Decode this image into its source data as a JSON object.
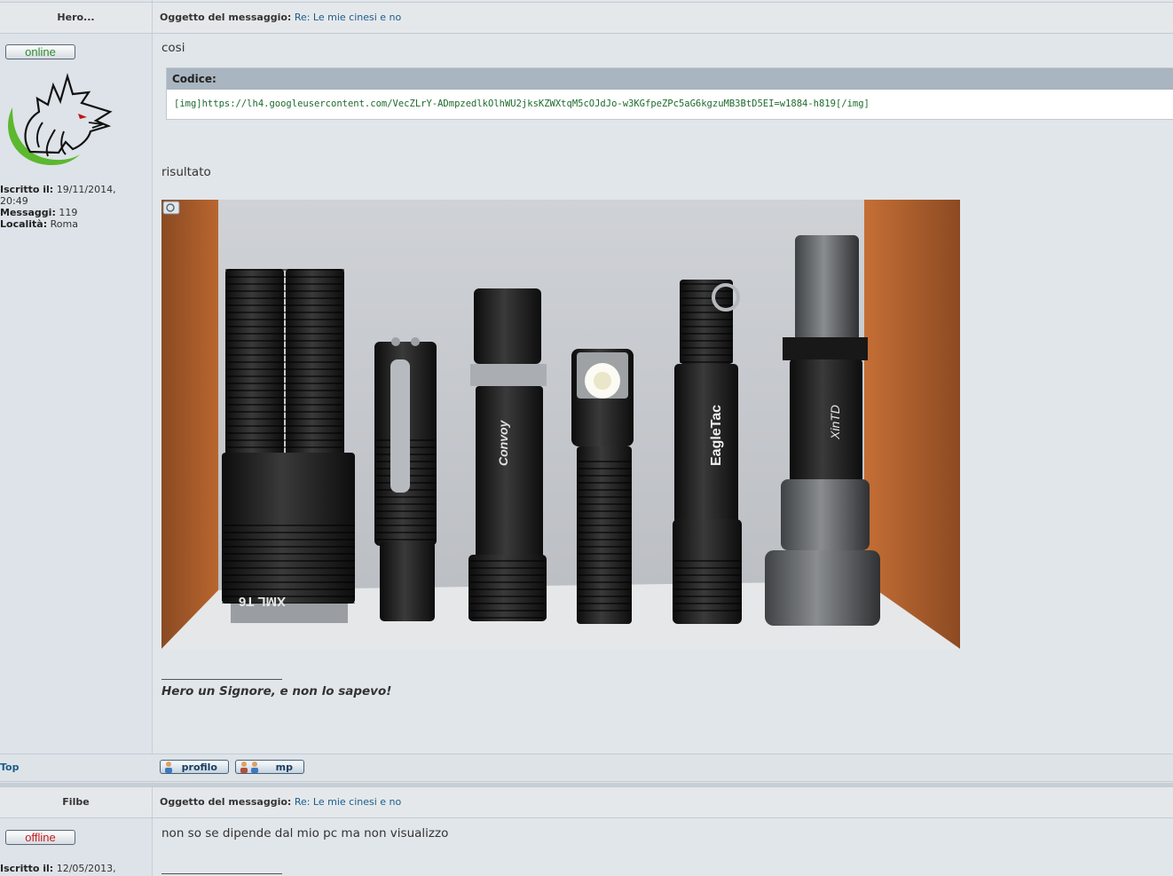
{
  "posts": [
    {
      "author": "Hero...",
      "subject_label": "Oggetto del messaggio:",
      "subject": "Re: Le mie cinesi e no",
      "status": "online",
      "joined_label": "Iscritto il:",
      "joined": "19/11/2014, 20:49",
      "joined_date": "19/11/2014,",
      "joined_time": "20:49",
      "messages_label": "Messaggi:",
      "messages": "119",
      "location_label": "Località:",
      "location": "Roma",
      "body_first": "cosi",
      "code_label": "Codice:",
      "code": "[img]https://lh4.googleusercontent.com/VecZLrY-ADmpzedlkOlhWU2jksKZWXtqM5cOJdJo-w3KGfpeZPc5aG6kgzuMB3BtD5EI=w1884-h819[/img]",
      "body_second": "risultato",
      "signature": "Hero un Signore, e non lo sapevo!",
      "top_link": "Top",
      "profile_button": "profilo",
      "pm_button": "mp"
    },
    {
      "author": "Filbe",
      "subject_label": "Oggetto del messaggio:",
      "subject": "Re: Le mie cinesi e no",
      "status": "offline",
      "joined_label": "Iscritto il:",
      "joined_date": "12/05/2013,",
      "body": "non so se dipende dal mio pc ma non visualizzo"
    }
  ],
  "photo": {
    "labels": [
      "XML T6",
      "Convoy",
      "EagleTac",
      "XinTD"
    ]
  },
  "colors": {
    "link": "#1a5c8c",
    "online": "#2e8a2e",
    "offline": "#c41e1e",
    "code_text": "#1e6b2c"
  }
}
